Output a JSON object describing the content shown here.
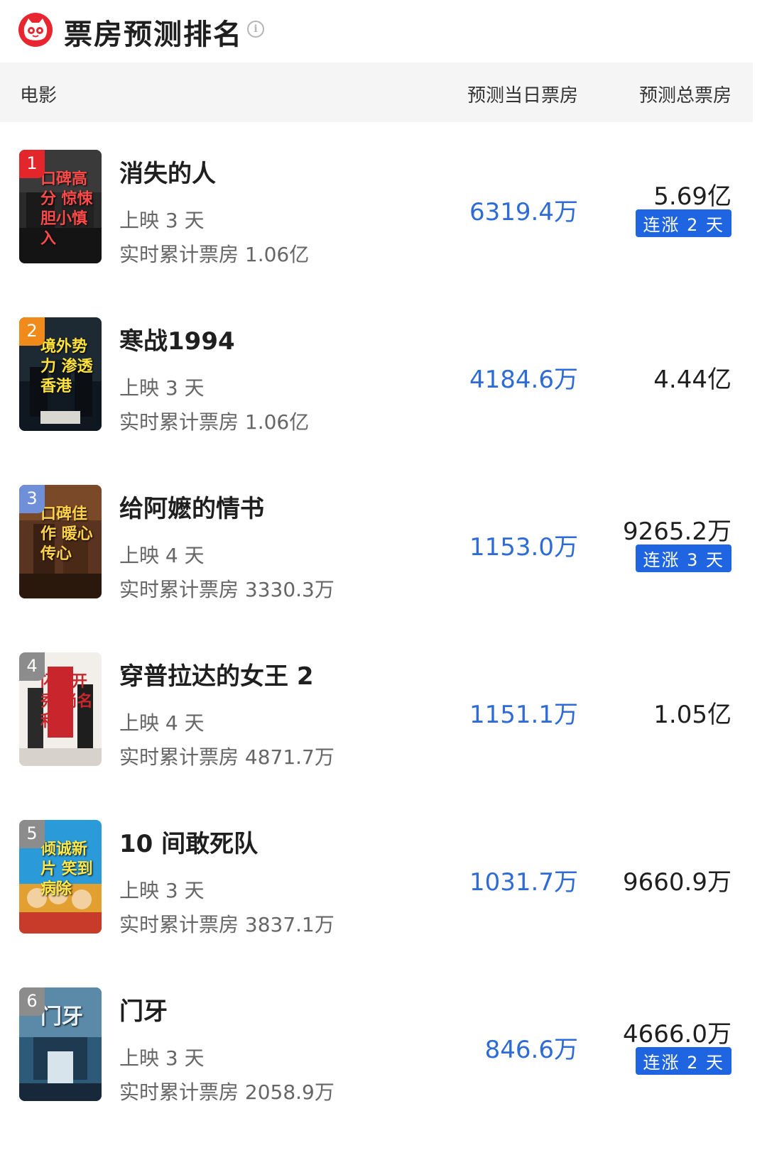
{
  "header": {
    "title": "票房预测排名",
    "logo_icon": "cat-logo-icon",
    "info_icon": "info-icon",
    "info_glyph": "i",
    "brand_color": "#e8262f"
  },
  "columns": {
    "movie": "电影",
    "daily": "预测当日票房",
    "total": "预测总票房"
  },
  "movies": [
    {
      "rank": "1",
      "title": "消失的人",
      "days": "上映 3 天",
      "cumulative": "实时累计票房 1.06亿",
      "daily": "6319.4万",
      "total": "5.69亿",
      "streak": "连涨 2 天",
      "poster_text": "口碑高分 惊悚 胆小慎入"
    },
    {
      "rank": "2",
      "title": "寒战1994",
      "days": "上映 3 天",
      "cumulative": "实时累计票房 1.06亿",
      "daily": "4184.6万",
      "total": "4.44亿",
      "streak": "",
      "poster_text": "境外势力 渗透香港"
    },
    {
      "rank": "3",
      "title": "给阿嬷的情书",
      "days": "上映 4 天",
      "cumulative": "实时累计票房 3330.3万",
      "daily": "1153.0万",
      "total": "9265.2万",
      "streak": "连涨 3 天",
      "poster_text": "口碑佳作 暖心传心"
    },
    {
      "rank": "4",
      "title": "穿普拉达的女王 2",
      "days": "上映 4 天",
      "cumulative": "实时累计票房 4871.7万",
      "daily": "1151.1万",
      "total": "1.05亿",
      "streak": "",
      "poster_text": "闪耀开秀 尚名利场"
    },
    {
      "rank": "5",
      "title": "10 间敢死队",
      "days": "上映 3 天",
      "cumulative": "实时累计票房 3837.1万",
      "daily": "1031.7万",
      "total": "9660.9万",
      "streak": "",
      "poster_text": "倾诚新片 笑到病除"
    },
    {
      "rank": "6",
      "title": "门牙",
      "days": "上映 3 天",
      "cumulative": "实时累计票房 2058.9万",
      "daily": "846.6万",
      "total": "4666.0万",
      "streak": "连涨 2 天",
      "poster_text": "门牙"
    }
  ],
  "colors": {
    "daily_value": "#2e6bd6",
    "streak_badge": "#1f64e0",
    "rank_1": "#e2262c",
    "rank_2": "#f08a1a",
    "rank_3": "#6f8fd8",
    "rank_other": "#8c8c8c"
  }
}
